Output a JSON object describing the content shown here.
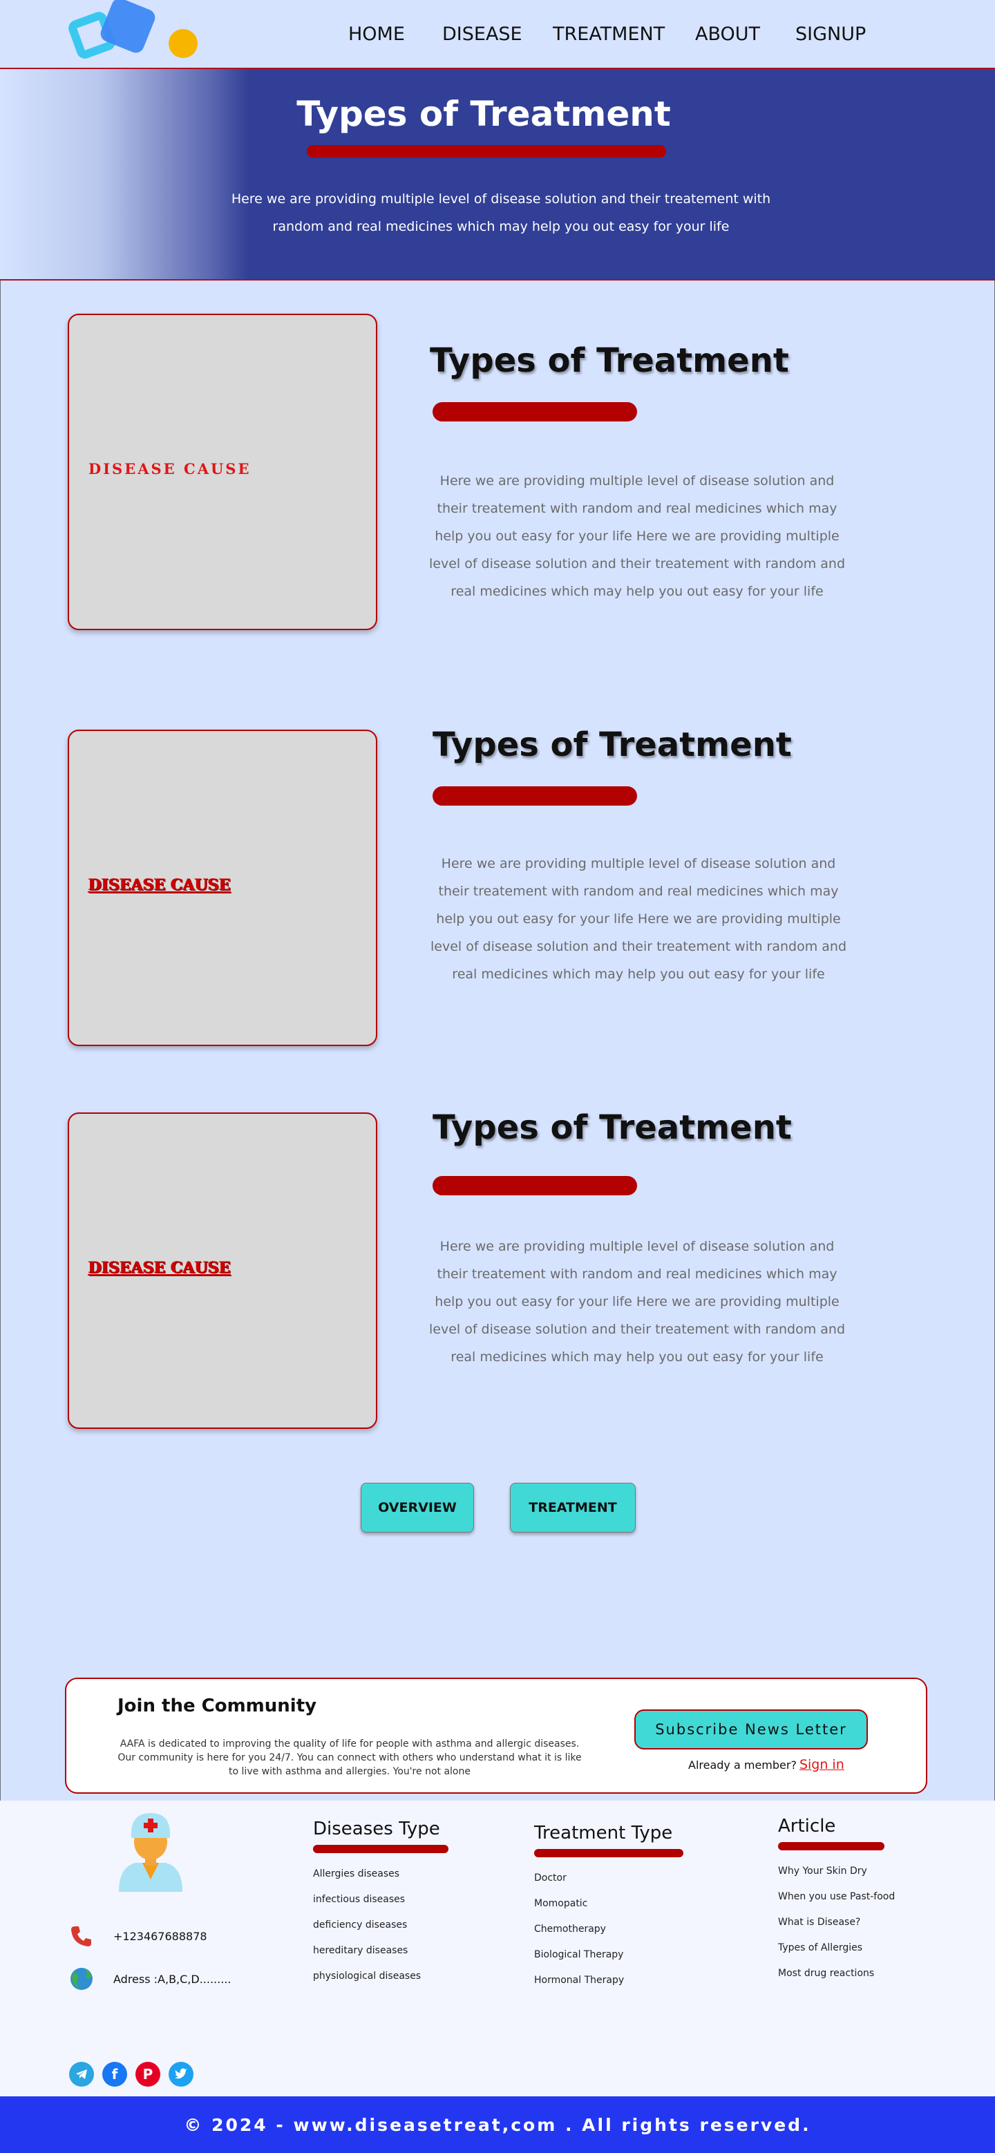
{
  "nav": {
    "items": [
      "HOME",
      "DISEASE",
      "TREATMENT",
      "ABOUT",
      "SIGNUP"
    ]
  },
  "hero": {
    "title": "Types of Treatment",
    "text": "Here we are providing multiple level of disease solution and their treatement with random and real medicines which may help you out easy for your life"
  },
  "sections": [
    {
      "card_label": "DISEASE CAUSE",
      "title": "Types of Treatment",
      "text": "Here we are providing multiple level of disease solution and their treatement with random and real medicines which may help you out easy for your life Here we are providing multiple level of disease solution and their treatement with random and real medicines which may help you out easy for your life"
    },
    {
      "card_label": "DISEASE CAUSE",
      "title": "Types of Treatment",
      "text": "Here we are providing multiple level of disease solution and their treatement with random and real medicines which may help you out easy for your life Here we are providing multiple level of disease solution and their treatement with random and real medicines which may help you out easy for your life"
    },
    {
      "card_label": "DISEASE CAUSE",
      "title": "Types of Treatment",
      "text": "Here we are providing multiple level of disease solution and their treatement with random and real medicines which may help you out easy for your life Here we are providing multiple level of disease solution and their treatement with random and real medicines which may help you out easy for your life"
    }
  ],
  "buttons": {
    "overview": "OVERVIEW",
    "treatment": "TREATMENT"
  },
  "community": {
    "title": "Join the Community",
    "text": "AAFA is dedicated to improving the quality of life for people with asthma and allergic diseases. Our community is here for you 24/7. You can connect with others who understand what it is like to live with asthma and allergies. You're not alone",
    "subscribe": "Subscribe News Letter",
    "member_text": "Already a member?",
    "sign_in": "Sign in"
  },
  "footer": {
    "phone": "+123467688878",
    "address": "Adress :A,B,C,D.........",
    "diseases": {
      "title": "Diseases Type",
      "items": [
        "Allergies  diseases",
        "infectious diseases",
        "deficiency diseases",
        "hereditary diseases",
        "physiological diseases"
      ]
    },
    "treatments": {
      "title": "Treatment Type",
      "items": [
        "Doctor",
        "Momopatic",
        "Chemotherapy",
        "Biological Therapy",
        "Hormonal Therapy"
      ]
    },
    "articles": {
      "title": "Article",
      "items": [
        "Why Your Skin Dry",
        "When you use Past-food",
        "What is Disease?",
        "Types of Allergies",
        "Most drug reactions"
      ]
    },
    "social_icons": [
      "telegram-icon",
      "facebook-icon",
      "pinterest-icon",
      "twitter-icon"
    ],
    "copyright": "© 2024 - www.diseasetreat,com . All rights reserved."
  },
  "colors": {
    "page_bg": "#d6e3ff",
    "hero_bg": "#313f96",
    "accent_red": "#b30000",
    "button_cyan": "#41d9d6",
    "copyright_bg": "#2337f0"
  }
}
